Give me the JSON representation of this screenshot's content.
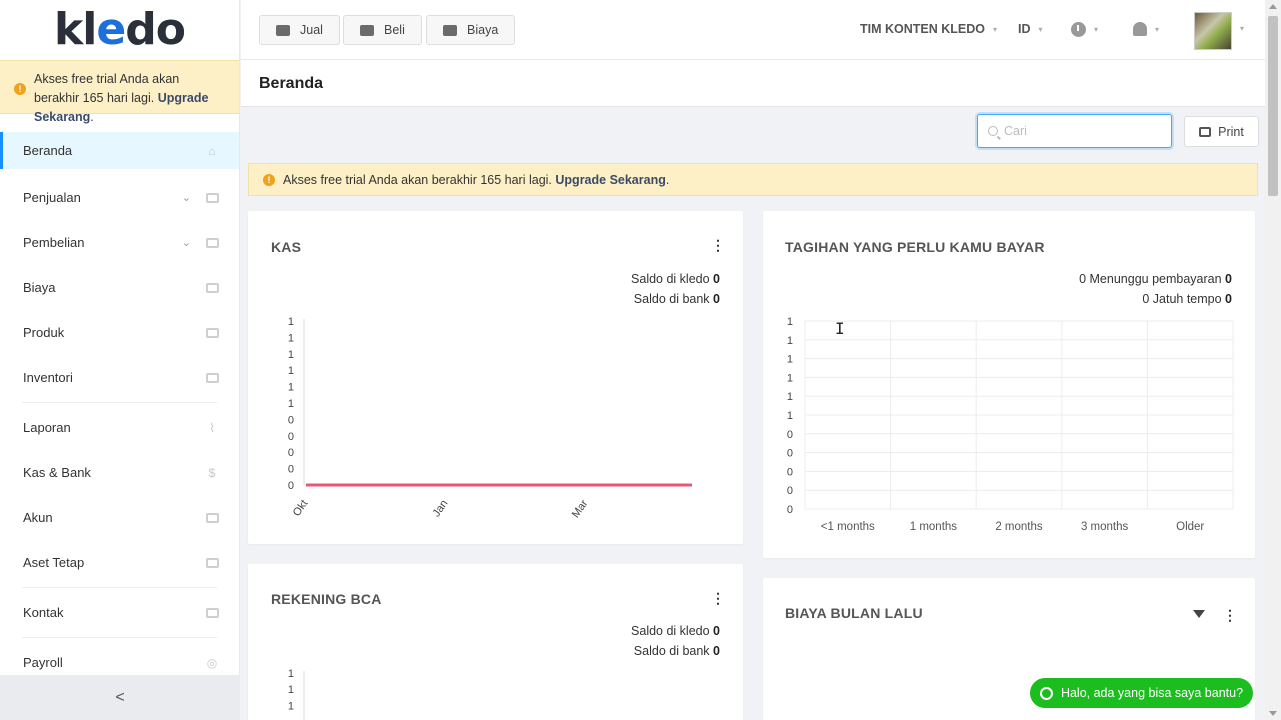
{
  "logo": {
    "pre": "kl",
    "mid": "e",
    "post": "do"
  },
  "trial_banner": {
    "text": "Akses free trial Anda akan berakhir 165 hari lagi.",
    "link": "Upgrade Sekarang",
    "suffix": "."
  },
  "sidebar": {
    "items": [
      {
        "label": "Beranda",
        "icon": "home-icon"
      },
      {
        "label": "Penjualan",
        "icon": "basket-icon"
      },
      {
        "label": "Pembelian",
        "icon": "bag-icon"
      },
      {
        "label": "Biaya",
        "icon": "card-icon"
      },
      {
        "label": "Produk",
        "icon": "box-icon"
      },
      {
        "label": "Inventori",
        "icon": "warehouse-icon"
      },
      {
        "label": "Laporan",
        "icon": "chart-icon"
      },
      {
        "label": "Kas & Bank",
        "icon": "dollar-icon"
      },
      {
        "label": "Akun",
        "icon": "ledger-icon"
      },
      {
        "label": "Aset Tetap",
        "icon": "building-icon"
      },
      {
        "label": "Kontak",
        "icon": "contact-card-icon"
      },
      {
        "label": "Payroll",
        "icon": "check-circle-icon"
      }
    ],
    "collapse": "<"
  },
  "topbar": {
    "buttons": [
      {
        "label": "Jual"
      },
      {
        "label": "Beli"
      },
      {
        "label": "Biaya"
      }
    ],
    "company": "TIM KONTEN KLEDO",
    "language": "ID"
  },
  "page": {
    "title": "Beranda"
  },
  "search": {
    "placeholder": "Cari"
  },
  "print": {
    "label": "Print"
  },
  "kas": {
    "title": "KAS",
    "saldo_kledo_label": "Saldo di kledo",
    "saldo_kledo": "0",
    "saldo_bank_label": "Saldo di bank",
    "saldo_bank": "0",
    "y_ticks": [
      "1",
      "1",
      "1",
      "1",
      "1",
      "1",
      "0",
      "0",
      "0",
      "0",
      "0"
    ],
    "x_ticks": [
      "Okt",
      "Jan",
      "Mar"
    ]
  },
  "tagihan": {
    "title": "TAGIHAN YANG PERLU KAMU BAYAR",
    "menunggu_count": "0",
    "menunggu_label": "Menunggu pembayaran",
    "menunggu_value": "0",
    "jatuh_count": "0",
    "jatuh_label": "Jatuh tempo",
    "jatuh_value": "0",
    "y_ticks": [
      "1",
      "1",
      "1",
      "1",
      "1",
      "1",
      "0",
      "0",
      "0",
      "0",
      "0"
    ],
    "x_ticks": [
      "<1 months",
      "1 months",
      "2 months",
      "3 months",
      "Older"
    ]
  },
  "rekening": {
    "title": "REKENING BCA",
    "saldo_kledo_label": "Saldo di kledo",
    "saldo_kledo": "0",
    "saldo_bank_label": "Saldo di bank",
    "saldo_bank": "0",
    "y_ticks": [
      "1",
      "1",
      "1"
    ]
  },
  "biaya": {
    "title": "BIAYA BULAN LALU"
  },
  "whatsapp": {
    "label": "Halo, ada yang bisa saya bantu?"
  },
  "chart_data": [
    {
      "type": "line",
      "title": "KAS",
      "x": [
        "Okt",
        "Jan",
        "Mar"
      ],
      "series": [
        {
          "values": [
            0,
            0,
            0
          ]
        }
      ],
      "color": "#e8577a"
    },
    {
      "type": "bar",
      "title": "TAGIHAN YANG PERLU KAMU BAYAR",
      "categories": [
        "<1 months",
        "1 months",
        "2 months",
        "3 months",
        "Older"
      ],
      "values": [
        0,
        0,
        0,
        0,
        0
      ]
    }
  ]
}
